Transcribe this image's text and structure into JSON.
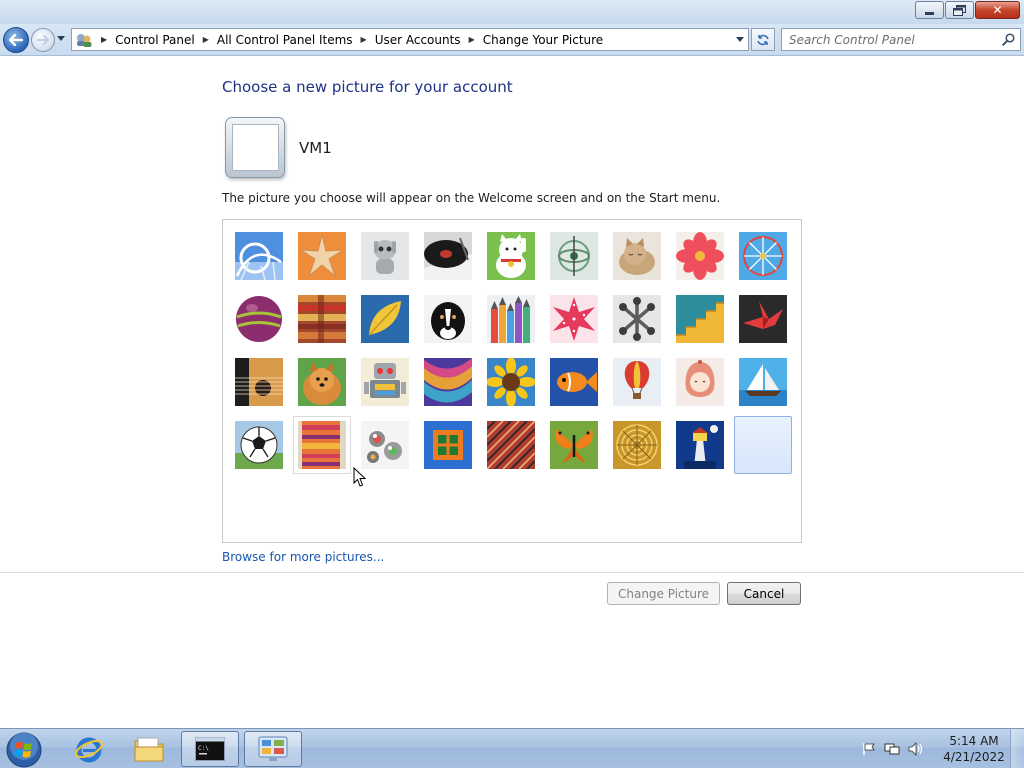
{
  "window": {
    "buttons": {
      "minimize_icon": "minimize-icon",
      "maximize_icon": "restore-icon",
      "close_icon": "close-icon"
    }
  },
  "nav": {
    "breadcrumbs": [
      "Control Panel",
      "All Control Panel Items",
      "User Accounts",
      "Change Your Picture"
    ],
    "search_placeholder": "Search Control Panel"
  },
  "content": {
    "heading": "Choose a new picture for your account",
    "username": "VM1",
    "description": "The picture you choose will appear on the Welcome screen and on the Start menu.",
    "pictures": [
      "roller-coaster",
      "starfish",
      "robot-figure",
      "record-player",
      "lucky-cat",
      "gyroscope",
      "kitten",
      "pink-flower",
      "ferris-wheel",
      "ball",
      "fabric",
      "leaf",
      "dog",
      "crayons",
      "star-ornament",
      "jacks",
      "stairs",
      "paper-crane",
      "guitar",
      "puppy",
      "toy-robot",
      "scarf",
      "sunflower",
      "fish",
      "hot-air-balloon",
      "doll",
      "sailboat",
      "soccer-ball",
      "textile",
      "marbles",
      "window",
      "woven-fabric",
      "butterfly",
      "spiral",
      "lighthouse",
      "blank"
    ],
    "selected_picture": "blank",
    "browse_link": "Browse for more pictures...",
    "change_button": "Change Picture",
    "change_button_state": "disabled",
    "cancel_button": "Cancel"
  },
  "taskbar": {
    "apps": [
      "internet-explorer",
      "windows-explorer",
      "command-prompt",
      "control-panel"
    ],
    "active_apps": [
      "command-prompt",
      "control-panel"
    ],
    "clock_time": "5:14 AM",
    "clock_date": "4/21/2022"
  }
}
